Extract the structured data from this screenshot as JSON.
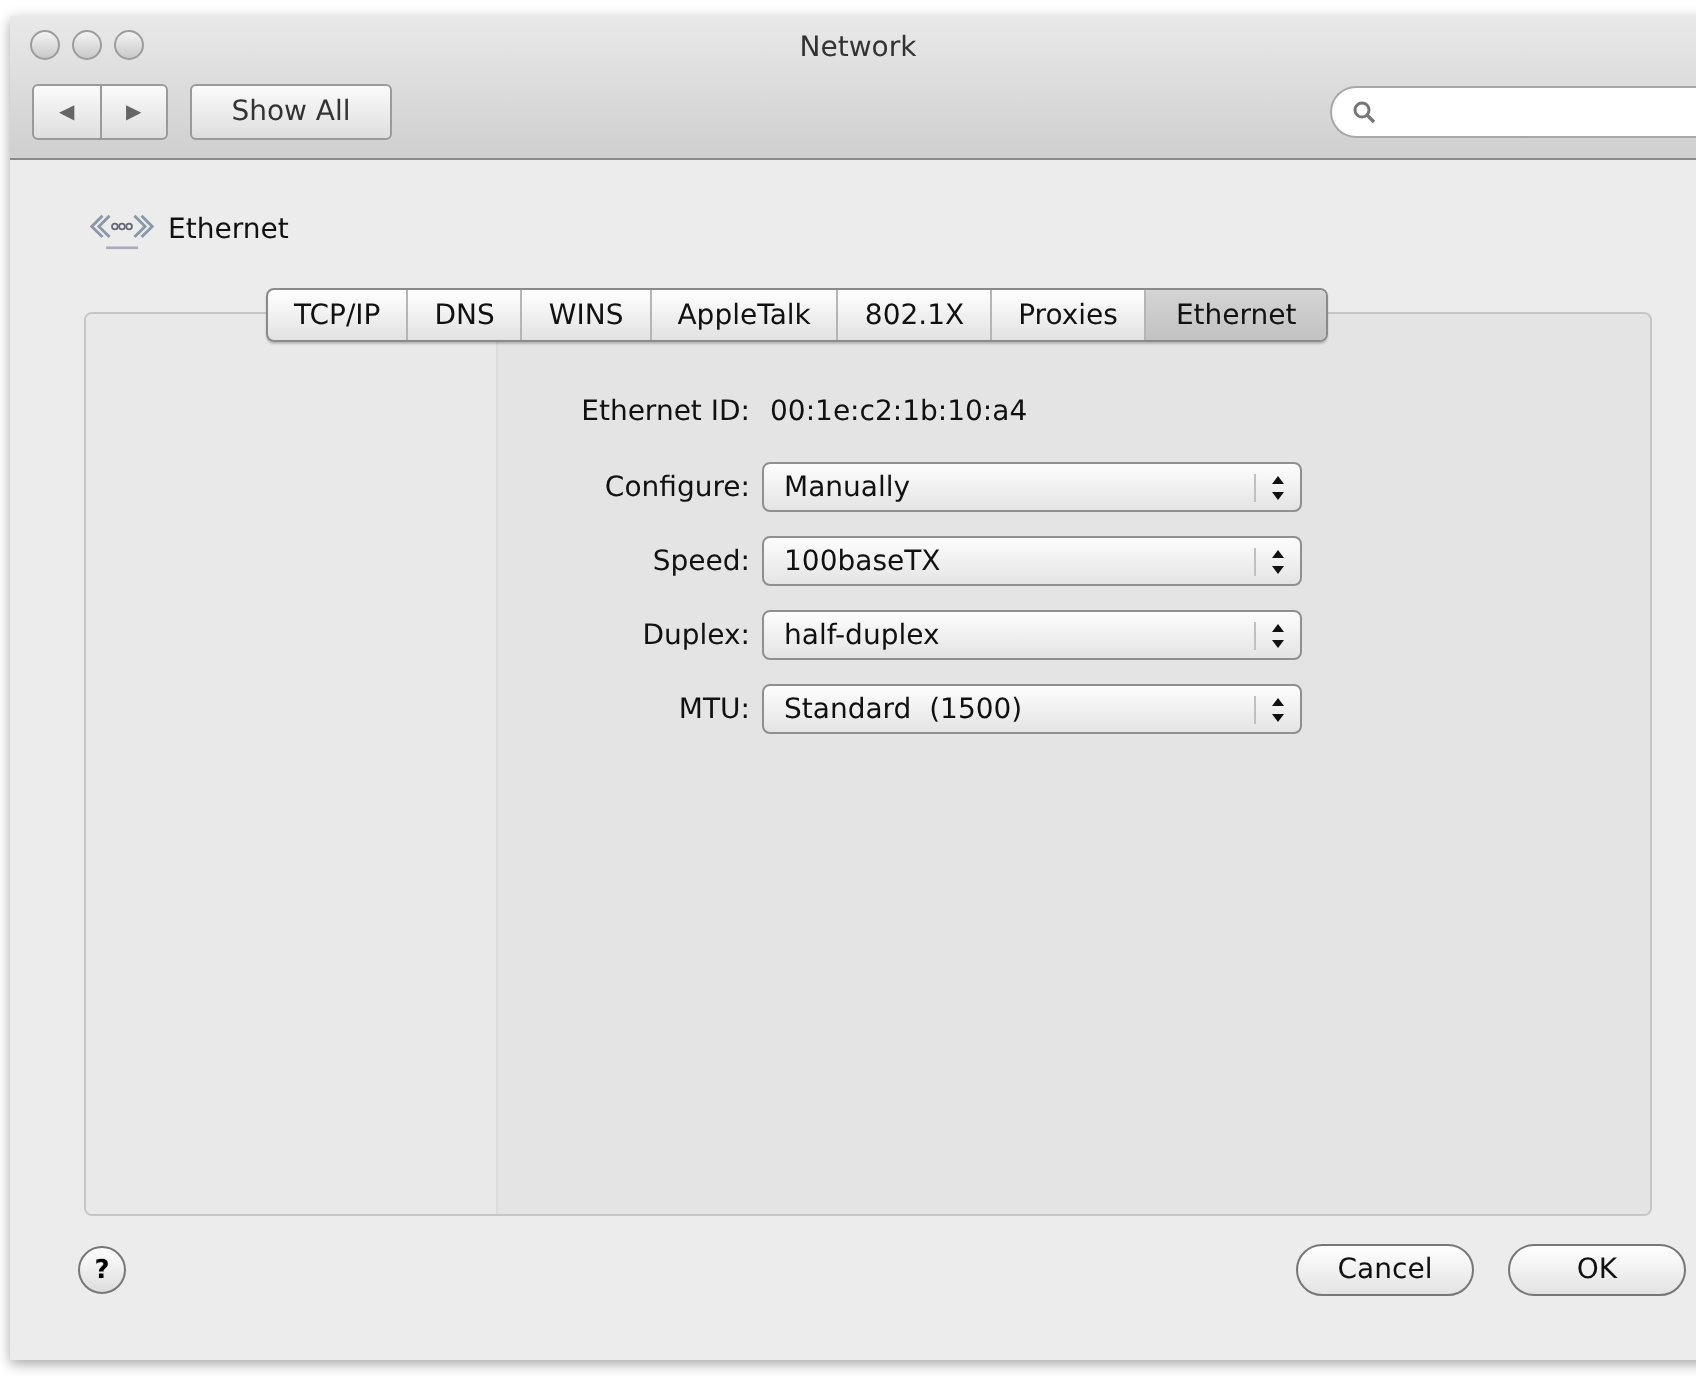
{
  "window": {
    "title": "Network"
  },
  "toolbar": {
    "back": "◀",
    "forward": "▶",
    "show_all": "Show All"
  },
  "service": {
    "name": "Ethernet"
  },
  "tabs": [
    {
      "label": "TCP/IP",
      "selected": false
    },
    {
      "label": "DNS",
      "selected": false
    },
    {
      "label": "WINS",
      "selected": false
    },
    {
      "label": "AppleTalk",
      "selected": false
    },
    {
      "label": "802.1X",
      "selected": false
    },
    {
      "label": "Proxies",
      "selected": false
    },
    {
      "label": "Ethernet",
      "selected": true
    }
  ],
  "ethernet_id": {
    "label": "Ethernet ID:",
    "value": "00:1e:c2:1b:10:a4"
  },
  "fields": [
    {
      "label": "Configure:",
      "value": "Manually"
    },
    {
      "label": "Speed:",
      "value": "100baseTX"
    },
    {
      "label": "Duplex:",
      "value": "half-duplex"
    },
    {
      "label": "MTU:",
      "value": "Standard  (1500)"
    }
  ],
  "help": "?",
  "buttons": [
    {
      "label": "Cancel"
    },
    {
      "label": "OK"
    }
  ]
}
